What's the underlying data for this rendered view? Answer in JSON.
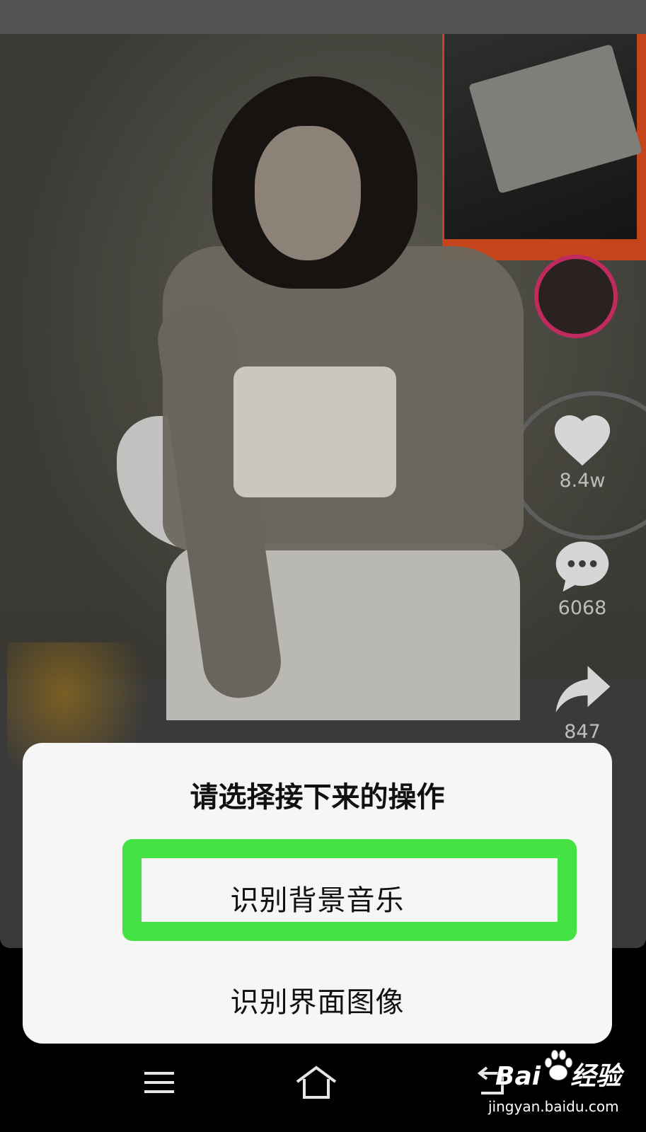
{
  "video": {
    "actions": {
      "like": {
        "icon": "heart-icon",
        "count": "8.4w"
      },
      "comment": {
        "icon": "comment-icon",
        "count": "6068"
      },
      "share": {
        "icon": "share-icon",
        "count": "847"
      }
    }
  },
  "dialog": {
    "title": "请选择接下来的操作",
    "options": [
      {
        "label": "识别背景音乐",
        "highlighted": true
      },
      {
        "label": "识别界面图像",
        "highlighted": false
      }
    ],
    "highlight_color": "#45e243"
  },
  "navbar": {
    "buttons": [
      "menu-icon",
      "home-icon",
      "back-icon"
    ]
  },
  "watermark": {
    "brand": "Bai",
    "brand_suffix": "经验",
    "url": "jingyan.baidu.com"
  }
}
